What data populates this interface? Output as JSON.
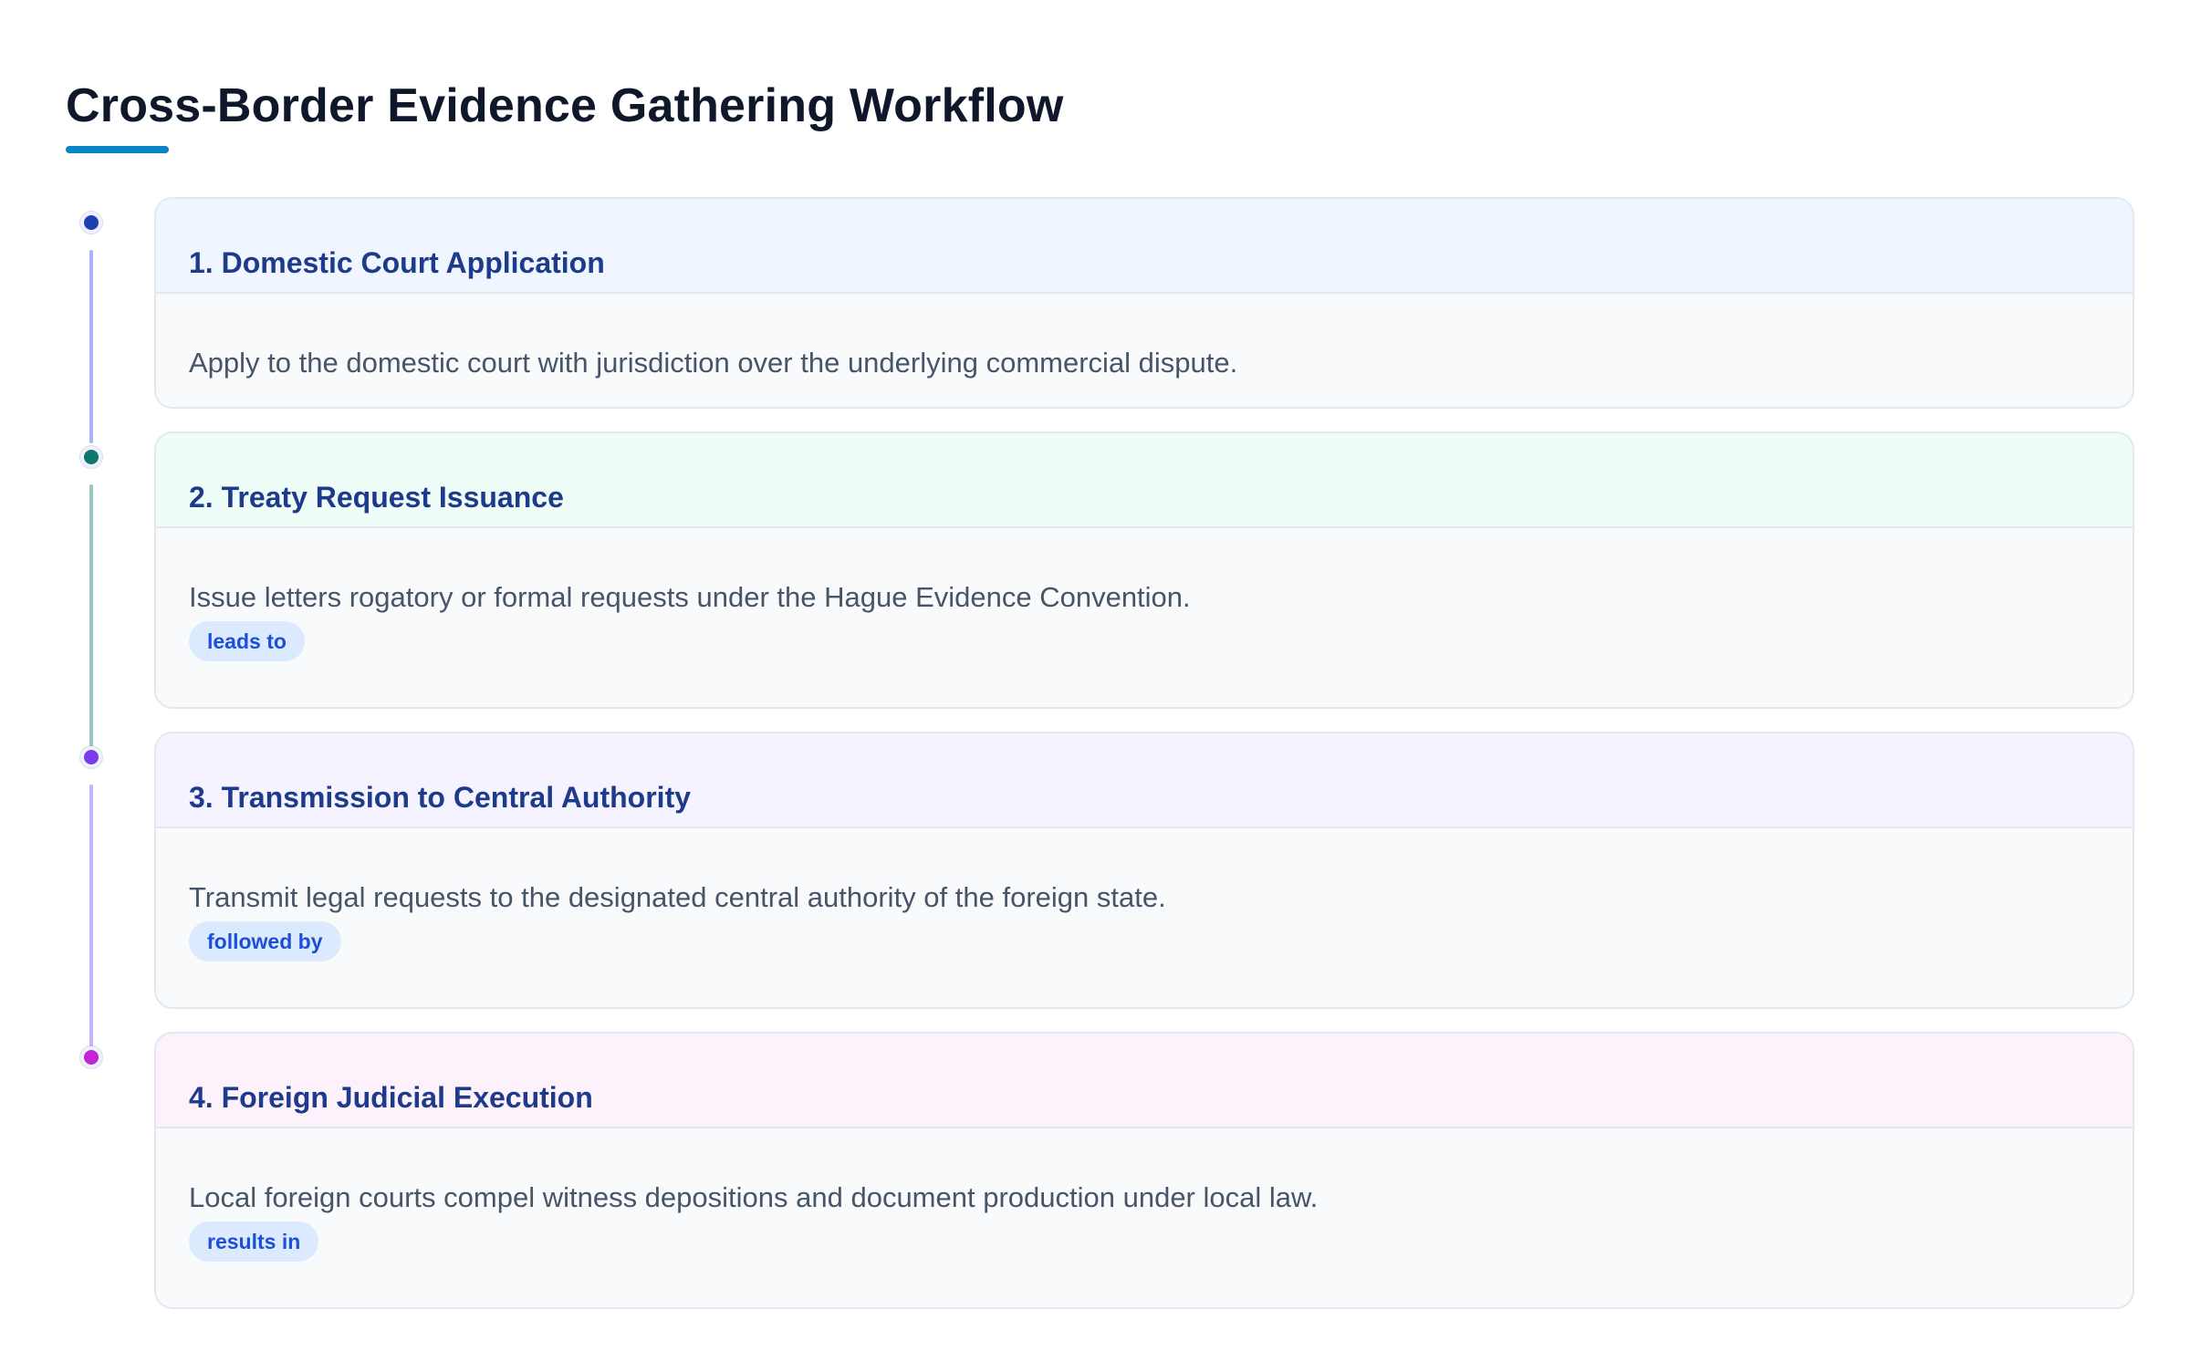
{
  "title": "Cross-Border Evidence Gathering Workflow",
  "colors": {
    "title_underline": "#0a84c6",
    "step_title": "#1e3a8a",
    "badge_text": "#1d4ed8",
    "badge_bg": "#dbeafe"
  },
  "steps": [
    {
      "title": "1. Domestic Court Application",
      "description": "Apply to the domestic court with jurisdiction over the underlying commercial dispute.",
      "relation": "",
      "dot_color": "#1e40af",
      "connector_color": "#a5b4fc",
      "header_color": "#eff6ff"
    },
    {
      "title": "2. Treaty Request Issuance",
      "description": "Issue letters rogatory or formal requests under the Hague Evidence Convention.",
      "relation": "leads to",
      "dot_color": "#0f766e",
      "connector_color": "#99c7c2",
      "header_color": "#effdf9"
    },
    {
      "title": "3. Transmission to Central Authority",
      "description": "Transmit legal requests to the designated central authority of the foreign state.",
      "relation": "followed by",
      "dot_color": "#7c3aed",
      "connector_color": "#c4b5fd",
      "header_color": "#f5f3ff"
    },
    {
      "title": "4. Foreign Judicial Execution",
      "description": "Local foreign courts compel witness depositions and document production under local law.",
      "relation": "results in",
      "dot_color": "#c026d3",
      "connector_color": "",
      "header_color": "#fdf2fb"
    }
  ]
}
